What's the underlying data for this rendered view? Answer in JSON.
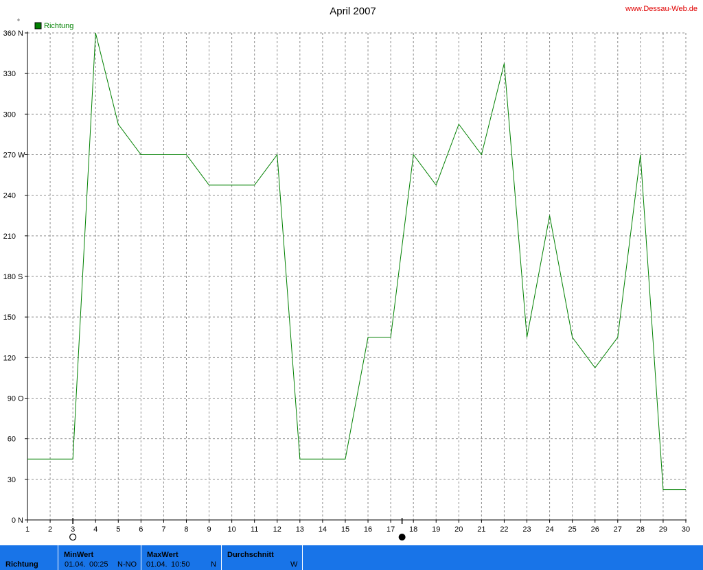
{
  "chart_data": {
    "type": "line",
    "title": "April 2007",
    "credit": "www.Dessau-Web.de",
    "y_unit": "°",
    "legend": {
      "label": "Richtung",
      "color": "#008000",
      "placement": "top-left"
    },
    "x": [
      1,
      2,
      3,
      4,
      5,
      6,
      7,
      8,
      9,
      10,
      11,
      12,
      13,
      14,
      15,
      16,
      17,
      18,
      19,
      20,
      21,
      22,
      23,
      24,
      25,
      26,
      27,
      28,
      29,
      30
    ],
    "series": [
      {
        "name": "Richtung",
        "color": "#008000",
        "values": [
          45,
          45,
          45,
          360,
          292.5,
          270,
          270,
          270,
          247.5,
          247.5,
          247.5,
          270,
          45,
          45,
          45,
          135,
          135,
          270,
          247.5,
          292.5,
          270,
          337.5,
          135,
          225,
          135,
          112.5,
          135,
          270,
          22.5,
          22.5
        ]
      }
    ],
    "xlim": [
      1,
      30
    ],
    "ylim": [
      0,
      360
    ],
    "x_ticks": [
      "1",
      "2",
      "3",
      "4",
      "5",
      "6",
      "7",
      "8",
      "9",
      "10",
      "11",
      "12",
      "13",
      "14",
      "15",
      "16",
      "17",
      "18",
      "19",
      "20",
      "21",
      "22",
      "23",
      "24",
      "25",
      "26",
      "27",
      "28",
      "29",
      "30"
    ],
    "y_ticks": [
      {
        "value": 0,
        "label": "0",
        "compass": "N"
      },
      {
        "value": 30,
        "label": "30",
        "compass": ""
      },
      {
        "value": 60,
        "label": "60",
        "compass": ""
      },
      {
        "value": 90,
        "label": "90",
        "compass": "O"
      },
      {
        "value": 120,
        "label": "120",
        "compass": ""
      },
      {
        "value": 150,
        "label": "150",
        "compass": ""
      },
      {
        "value": 180,
        "label": "180",
        "compass": "S"
      },
      {
        "value": 210,
        "label": "210",
        "compass": ""
      },
      {
        "value": 240,
        "label": "240",
        "compass": ""
      },
      {
        "value": 270,
        "label": "270",
        "compass": "W"
      },
      {
        "value": 300,
        "label": "300",
        "compass": ""
      },
      {
        "value": 330,
        "label": "330",
        "compass": ""
      },
      {
        "value": 360,
        "label": "360",
        "compass": "N"
      }
    ],
    "grid": true,
    "moon_phases": [
      {
        "day": 3,
        "phase": "full-moon"
      },
      {
        "day": 17.5,
        "phase": "new-moon"
      }
    ]
  },
  "footer": {
    "row_label": "Richtung",
    "min": {
      "header": "MinWert",
      "date": "01.04.",
      "time": "00:25",
      "value": "N-NO"
    },
    "max": {
      "header": "MaxWert",
      "date": "01.04.",
      "time": "10:50",
      "value": "N"
    },
    "avg": {
      "header": "Durchschnitt",
      "value": "W"
    }
  }
}
